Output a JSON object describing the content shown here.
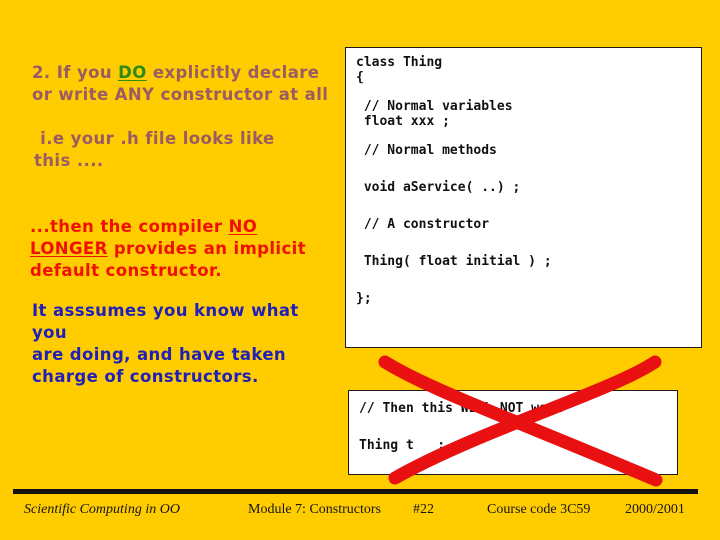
{
  "slide": {
    "background_color": "#FFCC00",
    "number": "#22"
  },
  "bullets": [
    {
      "id": "bullet-1",
      "color": "#9B5B63",
      "parts": [
        {
          "text": "2. If you ",
          "style": "plain"
        },
        {
          "text": "DO",
          "style": "green-underline"
        },
        {
          "text": " explicitly declare\nor write ANY constructor at all",
          "style": "plain"
        }
      ],
      "plain_text": "2. If you DO explicitly declare or write ANY constructor at all"
    },
    {
      "id": "bullet-2",
      "color": "#9B5B63",
      "parts": [
        {
          "text": " i.e your .h file looks like\nthis ....",
          "style": "plain"
        }
      ],
      "plain_text": "i.e your .h file looks like this ...."
    },
    {
      "id": "bullet-3",
      "color": "#F01000",
      "parts": [
        {
          "text": "...then the compiler ",
          "style": "plain"
        },
        {
          "text": "NO\nLONGER",
          "style": "red-underline"
        },
        {
          "text": " provides an implicit\ndefault constructor.",
          "style": "plain"
        }
      ],
      "plain_text": "...then the compiler NO LONGER provides an implicit default constructor."
    },
    {
      "id": "bullet-4",
      "color": "#2020B8",
      "parts": [
        {
          "text": "It asssumes you know what you\nare doing, and have taken\ncharge of constructors.",
          "style": "plain"
        }
      ],
      "plain_text": "It asssumes you know what you are doing, and have taken charge of constructors."
    }
  ],
  "code_main": {
    "lines": [
      "class Thing",
      "{",
      "",
      " // Normal variables",
      " float xxx ;",
      "",
      " // Normal methods",
      "",
      " void aService( ..) ;",
      "",
      " // A constructor",
      "",
      " Thing( float initial ) ;",
      "",
      "};"
    ],
    "l0": "class Thing",
    "l1": "{",
    "l2": " // Normal variables",
    "l3": " float xxx ;",
    "l4": " // Normal methods",
    "l5": " void aService( ..) ;",
    "l6": " // A constructor",
    "l7": " Thing( float initial ) ;",
    "l8": "};"
  },
  "code_usage": {
    "l0": "// Then this WILL NOT work",
    "l1": "Thing t   ;",
    "lines": [
      "// Then this WILL NOT work",
      "",
      "Thing t   ;"
    ]
  },
  "annotation": {
    "name": "red-cross-out",
    "color": "#E81010",
    "meaning": "crossed out - will not compile"
  },
  "footer": {
    "title": "Scientific Computing in OO",
    "module": "Module 7: Constructors",
    "slide_number": "#22",
    "course": "Course code 3C59",
    "year": "2000/2001"
  }
}
